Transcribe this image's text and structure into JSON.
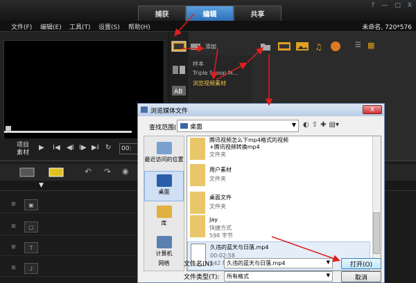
{
  "header": {
    "tabs": [
      {
        "label": "捕获"
      },
      {
        "label": "编辑"
      },
      {
        "label": "共享"
      }
    ],
    "window_controls": [
      "?",
      "—",
      "□",
      "X"
    ]
  },
  "menu": {
    "items": [
      "文件(F)",
      "编辑(E)",
      "工具(T)",
      "设置(S)",
      "帮助(H)"
    ],
    "title_info": "未命名, 720*576"
  },
  "player": {
    "project_label_line1": "项目",
    "project_label_line2": "素材",
    "timecode": "00:"
  },
  "library": {
    "add_label": "添加",
    "tree": [
      "样本",
      "Triple Scoop M...",
      "浏览视频素材"
    ]
  },
  "dialog": {
    "title": "浏览媒体文件",
    "look_in_label": "查找范围(I):",
    "look_in_value": "桌面",
    "places": [
      {
        "label": "最近访问的位置"
      },
      {
        "label": "桌面"
      },
      {
        "label": "库"
      },
      {
        "label": "计算机"
      },
      {
        "label": "网络"
      }
    ],
    "files": [
      {
        "name": "腾讯视频怎么下mp4格式的视频\n+腾讯视频转换mp4",
        "sub1": "文件夹",
        "sub2": ""
      },
      {
        "name": "用户素材",
        "sub1": "文件夹",
        "sub2": ""
      },
      {
        "name": "桌面文件",
        "sub1": "文件夹",
        "sub2": ""
      },
      {
        "name": "Jay",
        "sub1": "快捷方式",
        "sub2": "598 字节"
      },
      {
        "name": "久违的蓝天与日落.mp4",
        "sub1": "00:02:58",
        "sub2": "142 MB"
      }
    ],
    "filename_label": "文件名(N):",
    "filename_value": "久违的蓝天与日落.mp4",
    "filetype_label": "文件类型(T):",
    "filetype_value": "所有格式",
    "open_label": "打开(O)",
    "cancel_label": "取消",
    "close_label": "X"
  },
  "colors": {
    "accent": "#3a7fd0",
    "arrow": "#e0201c"
  }
}
